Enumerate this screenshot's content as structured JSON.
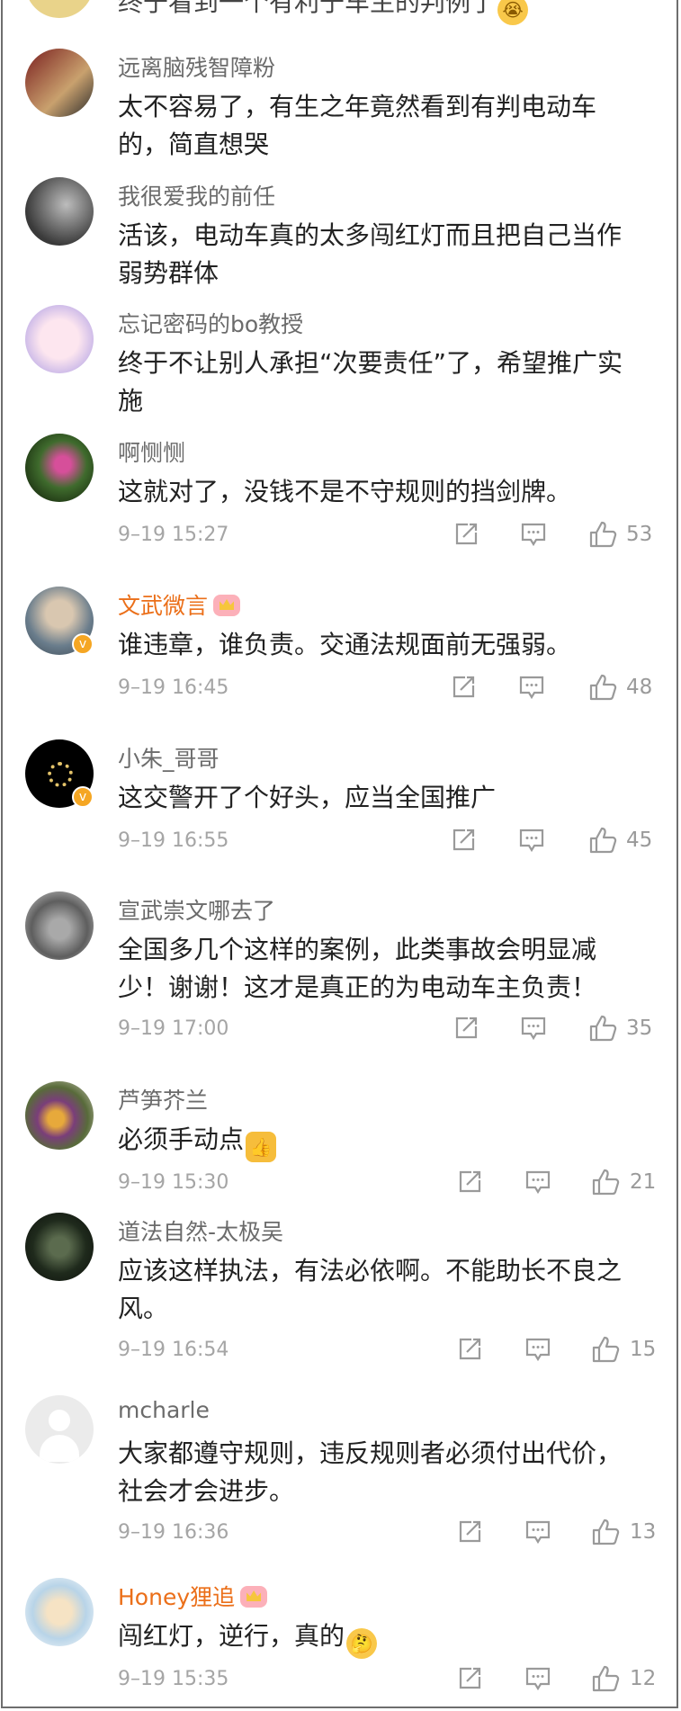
{
  "top_comment": {
    "text": "终于看到一个有利于车主的判例了"
  },
  "comments": [
    {
      "name": "远离脑残智障粉",
      "text": "太不容易了，有生之年竟然看到有判电动车的，简直想哭",
      "time": "",
      "likes": ""
    },
    {
      "name": "我很爱我的前任",
      "text": "活该，电动车真的太多闯红灯而且把自己当作弱势群体",
      "time": "",
      "likes": ""
    },
    {
      "name": "忘记密码的bo教授",
      "text": "终于不让别人承担“次要责任”了，希望推广实施",
      "time": "",
      "likes": ""
    },
    {
      "name": "啊恻恻",
      "text": "这就对了，没钱不是不守规则的挡剑牌。",
      "time": "9–19 15:27",
      "likes": "53"
    },
    {
      "name": "文武微言",
      "text": "谁违章，谁负责。交通法规面前无强弱。",
      "time": "9–19 16:45",
      "likes": "48"
    },
    {
      "name": "小朱_哥哥",
      "text": "这交警开了个好头，应当全国推广",
      "time": "9–19 16:55",
      "likes": "45"
    },
    {
      "name": "宣武崇文哪去了",
      "text": "全国多几个这样的案例，此类事故会明显减少！谢谢！这才是真正的为电动车主负责！",
      "time": "9–19 17:00",
      "likes": "35"
    },
    {
      "name": "芦笋芥兰",
      "text": "必须手动点",
      "time": "9–19 15:30",
      "likes": "21"
    },
    {
      "name": "道法自然-太极吴",
      "text": "应该这样执法，有法必依啊。不能助长不良之风。",
      "time": "9–19 16:54",
      "likes": "15"
    },
    {
      "name": "mcharle",
      "text": "大家都遵守规则，违反规则者必须付出代价，社会才会进步。",
      "time": "9–19 16:36",
      "likes": "13"
    },
    {
      "name": "Honey狸追",
      "text": "闯红灯，逆行，真的",
      "time": "9–19 15:35",
      "likes": "12"
    }
  ],
  "icons": {
    "repost": "repost-icon",
    "comment": "comment-icon",
    "like": "like-icon"
  },
  "colors": {
    "vip_name": "#eb6f19",
    "verified_badge": "#f5a623"
  }
}
